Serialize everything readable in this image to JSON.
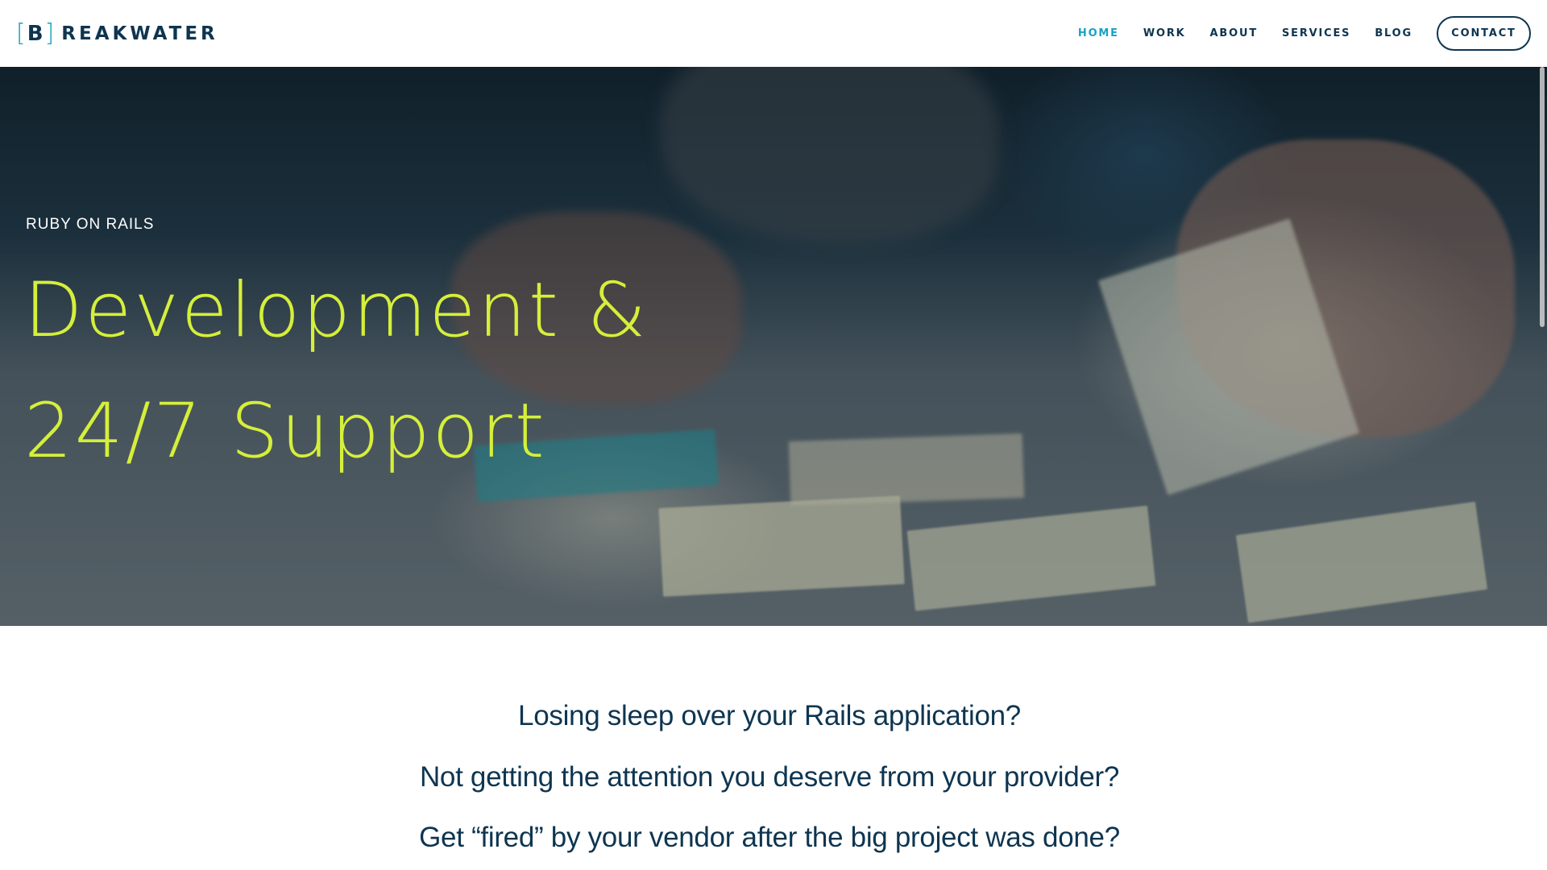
{
  "brand": {
    "bracket_open": "[",
    "initial": "B",
    "bracket_close": "]",
    "rest": "REAKWATER"
  },
  "nav": {
    "items": [
      {
        "label": "HOME",
        "active": true
      },
      {
        "label": "WORK",
        "active": false
      },
      {
        "label": "ABOUT",
        "active": false
      },
      {
        "label": "SERVICES",
        "active": false
      },
      {
        "label": "BLOG",
        "active": false
      }
    ],
    "contact_label": "CONTACT"
  },
  "hero": {
    "eyebrow": "RUBY ON RAILS",
    "title_line1": "Development &",
    "title_line2": "24/7 Support"
  },
  "intro": {
    "lines": [
      "Losing sleep over your Rails application?",
      "Not getting the attention you deserve from your provider?",
      "Get “fired” by your vendor after the big project was done?"
    ]
  },
  "colors": {
    "brand_dark": "#0e3550",
    "brand_accent": "#17a3c3",
    "hero_title": "#d5ef3a"
  }
}
